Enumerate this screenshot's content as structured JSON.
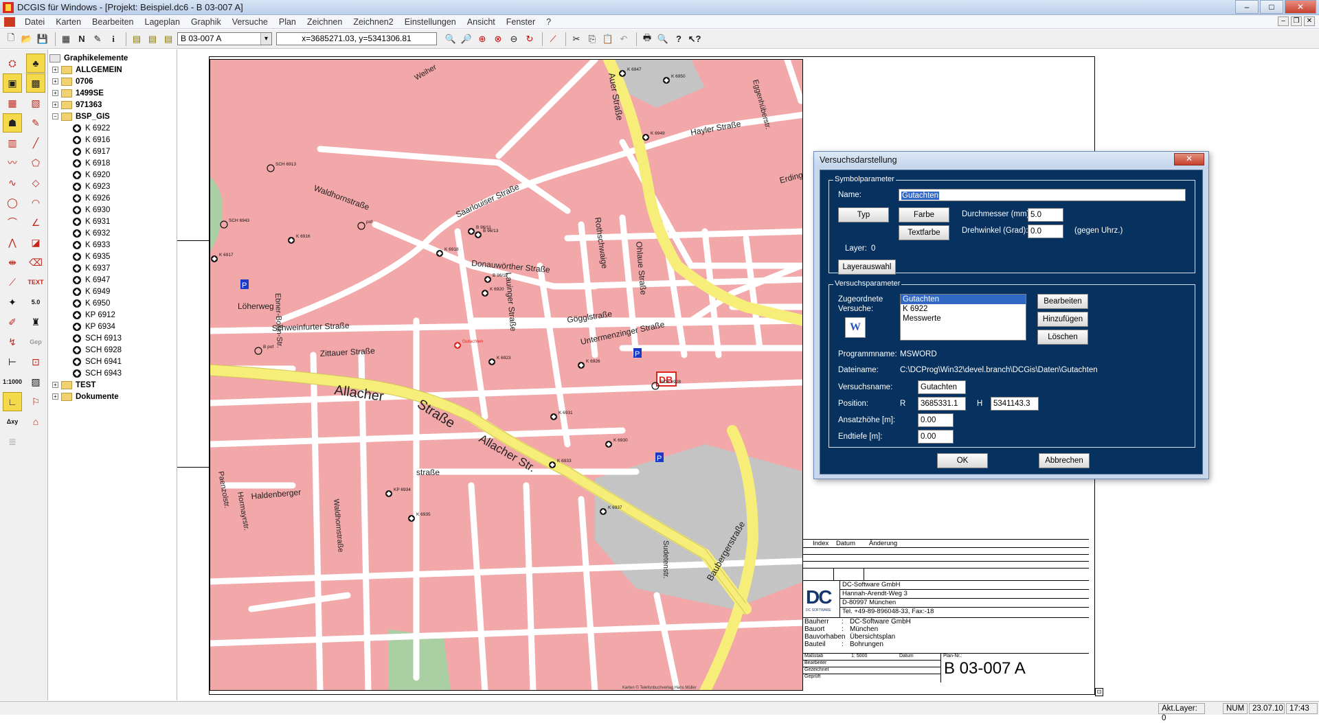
{
  "window": {
    "title": "DCGIS für Windows - [Projekt: Beispiel.dc6 - B 03-007 A]",
    "controls": [
      "–",
      "□",
      "✕"
    ]
  },
  "menu": [
    "Datei",
    "Karten",
    "Bearbeiten",
    "Lageplan",
    "Graphik",
    "Versuche",
    "Plan",
    "Zeichnen",
    "Zeichnen2",
    "Einstellungen",
    "Ansicht",
    "Fenster",
    "?"
  ],
  "toolbar": {
    "plan_select": "B 03-007 A",
    "coords": "x=3685271.03, y=5341306.81",
    "buttons": [
      "new",
      "open",
      "save",
      "print-setup",
      "N",
      "pen",
      "i",
      "grid1",
      "grid2",
      "grid3"
    ]
  },
  "left_tools": [
    "symbol",
    "bucket",
    "layer",
    "frame",
    "plan",
    "layers",
    "drill",
    "pen-red",
    "set",
    "line",
    "polyline",
    "polygon",
    "circle",
    "diamond",
    "arc",
    "arc2",
    "angle",
    "triangle",
    "mirror",
    "eraser",
    "dim",
    "TEXT",
    "bomb",
    "5.0",
    "pen-draw",
    "man",
    "arrow",
    "Gep",
    "pin",
    "frame2",
    "1:1000",
    "hatch",
    "rect-yellow",
    "signal",
    "Δxy",
    "house",
    "stack"
  ],
  "tree": {
    "root": "Graphikelemente",
    "items": [
      {
        "label": "ALLGEMEIN",
        "type": "folder",
        "exp": "+"
      },
      {
        "label": "0706",
        "type": "folder",
        "exp": "+"
      },
      {
        "label": "1499SE",
        "type": "folder",
        "exp": "+"
      },
      {
        "label": "971363",
        "type": "folder",
        "exp": "+"
      },
      {
        "label": "BSP_GIS",
        "type": "folder",
        "exp": "−"
      },
      {
        "label": "K 6922",
        "type": "leaf"
      },
      {
        "label": "K 6916",
        "type": "leaf"
      },
      {
        "label": "K 6917",
        "type": "leaf"
      },
      {
        "label": "K 6918",
        "type": "leaf"
      },
      {
        "label": "K 6920",
        "type": "leaf"
      },
      {
        "label": "K 6923",
        "type": "leaf"
      },
      {
        "label": "K 6926",
        "type": "leaf"
      },
      {
        "label": "K 6930",
        "type": "leaf"
      },
      {
        "label": "K 6931",
        "type": "leaf"
      },
      {
        "label": "K 6932",
        "type": "leaf"
      },
      {
        "label": "K 6933",
        "type": "leaf"
      },
      {
        "label": "K 6935",
        "type": "leaf"
      },
      {
        "label": "K 6937",
        "type": "leaf"
      },
      {
        "label": "K 6947",
        "type": "leaf"
      },
      {
        "label": "K 6949",
        "type": "leaf"
      },
      {
        "label": "K 6950",
        "type": "leaf"
      },
      {
        "label": "KP 6912",
        "type": "leaf"
      },
      {
        "label": "KP 6934",
        "type": "leaf"
      },
      {
        "label": "SCH 6913",
        "type": "leaf"
      },
      {
        "label": "SCH 6928",
        "type": "leaf"
      },
      {
        "label": "SCH 6941",
        "type": "leaf"
      },
      {
        "label": "SCH 6943",
        "type": "leaf"
      },
      {
        "label": "TEST",
        "type": "folder",
        "exp": "+"
      },
      {
        "label": "Dokumente",
        "type": "folder",
        "exp": "+"
      }
    ]
  },
  "map": {
    "streets": [
      "Allacher",
      "Straße",
      "Allacher Str.",
      "Waldhornstraße",
      "Saarlouiser Straße",
      "Donauwörther Straße",
      "Löherweg",
      "Schweinfurter Straße",
      "Zittauer Straße",
      "Gögglstraße",
      "Untermenzinger Straße",
      "Lauinger Straße",
      "Baubergerstraße",
      "Haldenberger",
      "straße",
      "Hayler Straße",
      "Ohlaue Straße",
      "Rothschwaige",
      "Ebner-Bollin-Str.",
      "Hormayrstr.",
      "Auer Straße",
      "Weiher",
      "Sudetenstr.",
      "Paenzolstr.",
      "Waldhornstraße",
      "Eggenhüberstr.",
      "Erdinger"
    ],
    "points": [
      "K 6947",
      "K 6950",
      "K 6949",
      "SCH 6913",
      "SCH 6943",
      "K 6916",
      "K 6917",
      "K 6918",
      "B 96/11",
      "B 96/13",
      "B 96/12",
      "K 6920",
      "Gutachten",
      "B pof",
      "pof",
      "K 6923",
      "K 6926",
      "SCH 6928",
      "K 6931",
      "K 6930",
      "K 6933",
      "KP 6934",
      "K 6935",
      "K 6937"
    ],
    "badges": {
      "parking": "P",
      "db": "DB"
    },
    "colors": {
      "built_area": "#f2a7a9",
      "roads": "#ffffff",
      "main_road": "#f6ee79",
      "industrial": "#c4c4c4",
      "park": "#a9cfa3",
      "symbol_red": "#e0231b"
    },
    "copyright": "Karten © Telefonbuchverlag Hans Müller"
  },
  "title_block": {
    "rev_headers": [
      "Index",
      "Datum",
      "Änderung"
    ],
    "company_lines": [
      "DC-Software GmbH",
      "Hannah-Arendt-Weg 3",
      "D-80997 München",
      "Tel. +49-89-896048-33, Fax:-18"
    ],
    "logo": "DC SOFTWARE",
    "info": [
      {
        "k": "Bauherr",
        "v": "DC-Software GmbH"
      },
      {
        "k": "Bauort",
        "v": "München"
      },
      {
        "k": "Bauvorhaben",
        "v": "Übersichtsplan"
      },
      {
        "k": "Bauteil",
        "v": "Bohrungen"
      }
    ],
    "scale_label": "Maßstab",
    "scale_value": "1: 5000",
    "date_label": "Datum",
    "plan_label": "Plan-Nr.:",
    "sig_rows": [
      "Bearbeiter",
      "Gezeichnet",
      "Geprüft"
    ],
    "plan_no": "B 03-007 A"
  },
  "dialog": {
    "title": "Versuchsdarstellung",
    "close": "✕",
    "symbol": {
      "legend": "Symbolparameter",
      "name_label": "Name:",
      "name_value": "Gutachten",
      "typ_button": "Typ",
      "farbe_button": "Farbe",
      "textfarbe_button": "Textfarbe",
      "durchmesser_label": "Durchmesser (mm):",
      "durchmesser_value": "5.0",
      "drehwinkel_label": "Drehwinkel (Grad):",
      "drehwinkel_value": "0.0",
      "drehwinkel_unit": "(gegen Uhrz.)",
      "layer_label": "Layer:",
      "layer_value": "0",
      "layerauswahl_button": "Layerauswahl"
    },
    "versuch": {
      "legend": "Versuchsparameter",
      "zugeordnete_label": "Zugeordnete",
      "versuche_label": "Versuche:",
      "list": [
        "Gutachten",
        "K 6922",
        "Messwerte"
      ],
      "selected_index": 0,
      "bearbeiten_button": "Bearbeiten",
      "hinzufuegen_button": "Hinzufügen",
      "loeschen_button": "Löschen",
      "word_icon": "W",
      "programmname_label": "Programmname:",
      "programmname_value": "MSWORD",
      "dateiname_label": "Dateiname:",
      "dateiname_value": "C:\\DCProg\\Win32\\devel.branch\\DCGis\\Daten\\Gutachten",
      "versuchsname_label": "Versuchsname:",
      "versuchsname_value": "Gutachten",
      "position_label": "Position:",
      "r_label": "R",
      "r_value": "3685331.1",
      "h_label": "H",
      "h_value": "5341143.3",
      "ansatz_label": "Ansatzhöhe [m]:",
      "ansatz_value": "0.00",
      "endtiefe_label": "Endtiefe [m]:",
      "endtiefe_value": "0.00"
    },
    "ok_button": "OK",
    "cancel_button": "Abbrechen"
  },
  "status": {
    "layer": "Akt.Layer: 0",
    "num": "NUM",
    "date": "23.07.10",
    "time": "17:43"
  }
}
